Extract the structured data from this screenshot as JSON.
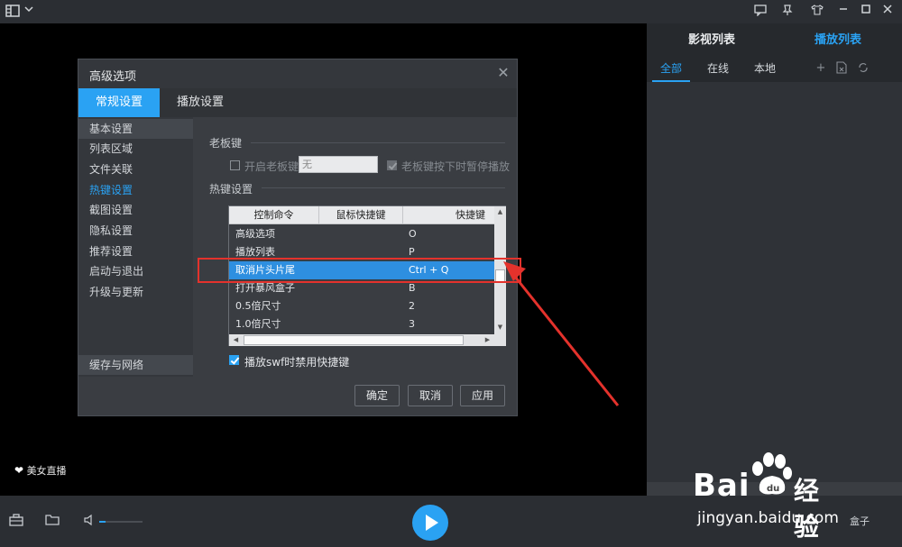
{
  "topbar": {
    "icons": [
      "menu-icon",
      "chevron-down-icon",
      "message-icon",
      "pin-icon",
      "shirt-icon",
      "minimize-icon",
      "maximize-icon",
      "close-icon"
    ]
  },
  "right_panel": {
    "tabs": [
      "影视列表",
      "播放列表"
    ],
    "active_tab": "播放列表",
    "subtabs": [
      "全部",
      "在线",
      "本地"
    ],
    "active_subtab": "全部"
  },
  "live_badge": "美女直播",
  "dialog": {
    "title": "高级选项",
    "tabs": [
      "常规设置",
      "播放设置"
    ],
    "active_tab": "常规设置",
    "sidebar": [
      "基本设置",
      "列表区域",
      "文件关联",
      "热键设置",
      "截图设置",
      "隐私设置",
      "推荐设置",
      "启动与退出",
      "升级与更新"
    ],
    "sidebar_bottom": "缓存与网络",
    "sidebar_selected": "基本设置",
    "sidebar_highlight": "热键设置",
    "boss_key": {
      "section": "老板键",
      "enable_label": "开启老板键",
      "enable_checked": false,
      "key_value": "无",
      "pause_label": "老板键按下时暂停播放",
      "pause_checked": true
    },
    "hotkeys": {
      "section": "热键设置",
      "columns": [
        "控制命令",
        "鼠标快捷键",
        "快捷键"
      ],
      "rows": [
        {
          "command": "高级选项",
          "mouse": "",
          "key": "O"
        },
        {
          "command": "播放列表",
          "mouse": "",
          "key": "P"
        },
        {
          "command": "取消片头片尾",
          "mouse": "",
          "key": "Ctrl + Q"
        },
        {
          "command": "打开暴风盒子",
          "mouse": "",
          "key": "B"
        },
        {
          "command": "0.5倍尺寸",
          "mouse": "",
          "key": "2"
        },
        {
          "command": "1.0倍尺寸",
          "mouse": "",
          "key": "3"
        }
      ],
      "selected_row": 2,
      "swf_label": "播放swf时禁用快捷键",
      "swf_checked": true
    },
    "buttons": {
      "ok": "确定",
      "cancel": "取消",
      "apply": "应用"
    }
  },
  "controlbar": {
    "icons": [
      "toolbox-icon",
      "folder-icon",
      "volume-icon",
      "play-icon"
    ],
    "volume": 0.15,
    "box_label": "盒子"
  },
  "watermark": {
    "brand": "Bai",
    "brand2": "经验",
    "url": "jingyan.baidu.com"
  },
  "colors": {
    "accent": "#2aa2f3",
    "annotation": "#e4322c",
    "background": "#000000"
  }
}
